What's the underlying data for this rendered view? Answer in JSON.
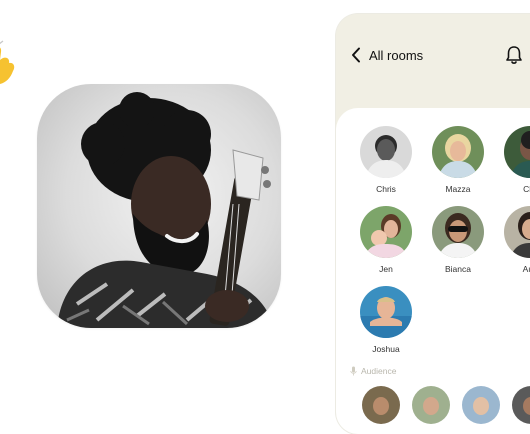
{
  "header": {
    "back_label": "All rooms",
    "back_icon": "chevron-left-icon",
    "bell_icon": "bell-icon"
  },
  "room": {
    "speakers": [
      {
        "name": "Chris"
      },
      {
        "name": "Mazza"
      },
      {
        "name": "Chr"
      },
      {
        "name": "Jen"
      },
      {
        "name": "Bianca"
      },
      {
        "name": "Aus"
      },
      {
        "name": "Joshua"
      }
    ],
    "audience_label": "Audience"
  },
  "colors": {
    "header_bg": "#f1efe4",
    "card_bg": "#ffffff",
    "accent_text": "#111111"
  }
}
